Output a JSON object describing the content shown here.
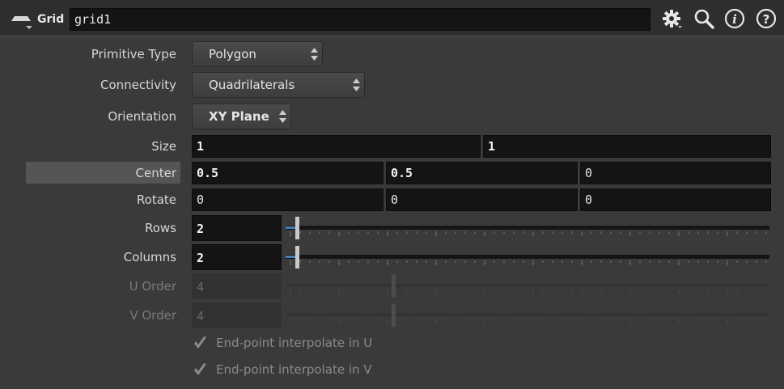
{
  "header": {
    "node_type": "Grid",
    "node_name": "grid1",
    "icons": [
      "node-type-icon",
      "gear-icon",
      "search-icon",
      "info-icon",
      "help-icon"
    ]
  },
  "params": {
    "primitive_type": {
      "label": "Primitive Type",
      "value": "Polygon"
    },
    "connectivity": {
      "label": "Connectivity",
      "value": "Quadrilaterals"
    },
    "orientation": {
      "label": "Orientation",
      "value": "XY Plane"
    },
    "size": {
      "label": "Size",
      "values": [
        "1",
        "1"
      ]
    },
    "center": {
      "label": "Center",
      "values": [
        "0.5",
        "0.5",
        "0"
      ]
    },
    "rotate": {
      "label": "Rotate",
      "values": [
        "0",
        "0",
        "0"
      ]
    },
    "rows": {
      "label": "Rows",
      "value": "2"
    },
    "columns": {
      "label": "Columns",
      "value": "2"
    },
    "u_order": {
      "label": "U Order",
      "value": "4"
    },
    "v_order": {
      "label": "V Order",
      "value": "4"
    },
    "endpoint_u": {
      "label": "End-point interpolate in U",
      "checked": true
    },
    "endpoint_v": {
      "label": "End-point interpolate in V",
      "checked": true
    }
  },
  "colors": {
    "background": "#3a3a3a",
    "field": "#141414",
    "slider_accent": "#4a7fb5",
    "highlight_row": "#555555"
  }
}
